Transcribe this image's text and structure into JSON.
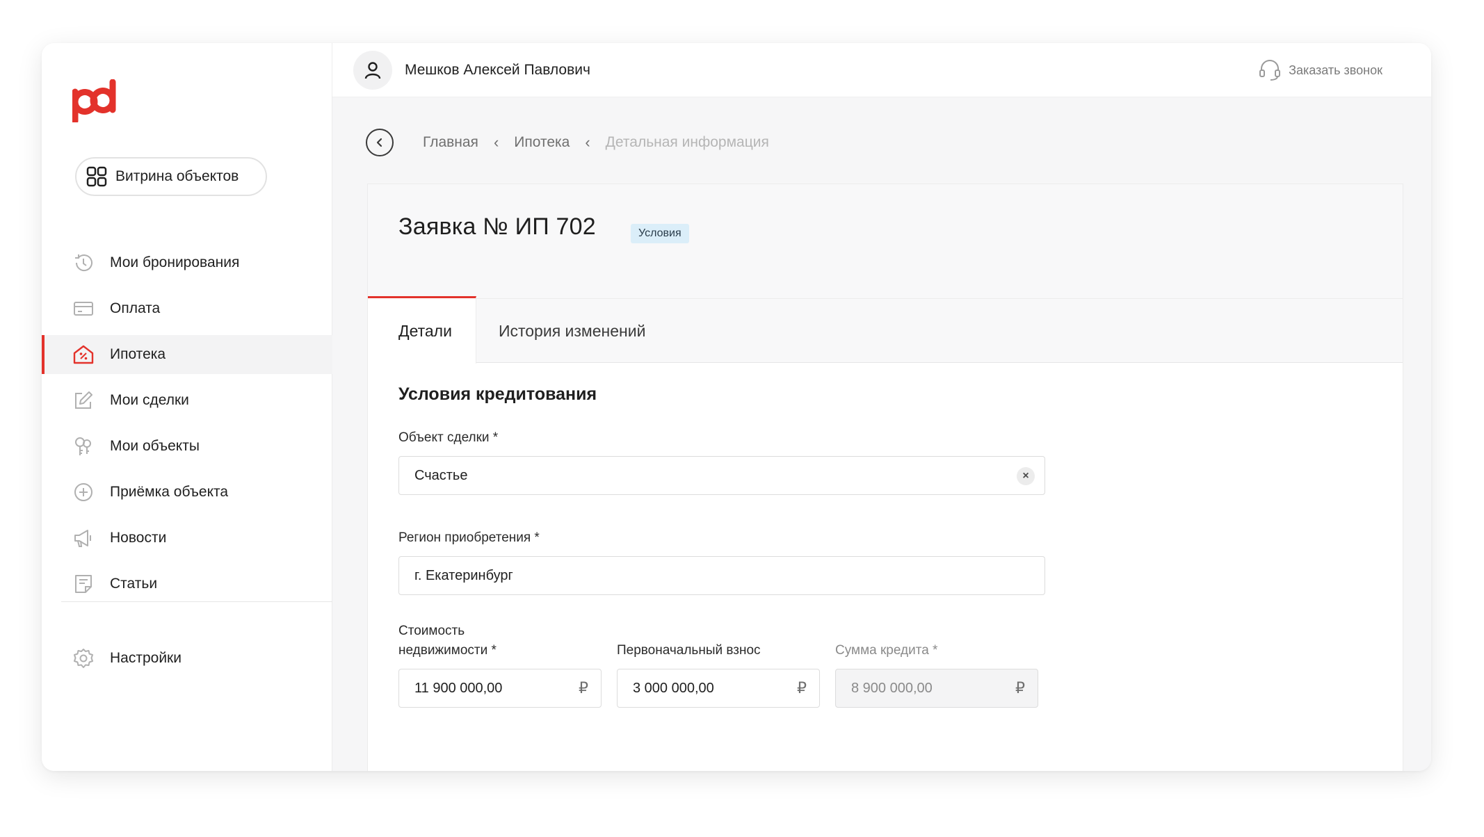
{
  "sidebar": {
    "vitrina_label": "Витрина объектов",
    "items": [
      {
        "label": "Мои бронирования",
        "icon": "history-icon"
      },
      {
        "label": "Оплата",
        "icon": "card-icon"
      },
      {
        "label": "Ипотека",
        "icon": "mortgage-house-icon",
        "active": true
      },
      {
        "label": "Мои сделки",
        "icon": "edit-icon"
      },
      {
        "label": "Мои объекты",
        "icon": "keys-icon"
      },
      {
        "label": "Приёмка объекта",
        "icon": "plus-circle-icon"
      },
      {
        "label": "Новости",
        "icon": "megaphone-icon"
      },
      {
        "label": "Статьи",
        "icon": "article-icon"
      }
    ],
    "settings_label": "Настройки"
  },
  "header": {
    "user_name": "Мешков Алексей Павлович",
    "call_label": "Заказать звонок"
  },
  "breadcrumbs": {
    "home": "Главная",
    "section": "Ипотека",
    "current": "Детальная информация"
  },
  "application": {
    "title": "Заявка № ИП 702",
    "status_badge": "Условия"
  },
  "tabs": {
    "details": "Детали",
    "history": "История изменений"
  },
  "form": {
    "section_title": "Условия кредитования",
    "object_label": "Объект сделки *",
    "object_value": "Счастье",
    "region_label": "Регион приобретения *",
    "region_value": "г. Екатеринбург",
    "cost_label": "Стоимость недвижимости *",
    "cost_value": "11 900 000,00",
    "down_payment_label": "Первоначальный взнос",
    "down_payment_value": "3 000 000,00",
    "loan_amount_label": "Сумма кредита *",
    "loan_amount_value": "8 900 000,00",
    "currency_symbol": "₽"
  },
  "colors": {
    "accent": "#e3322b",
    "badge_bg": "#dbeef9"
  }
}
